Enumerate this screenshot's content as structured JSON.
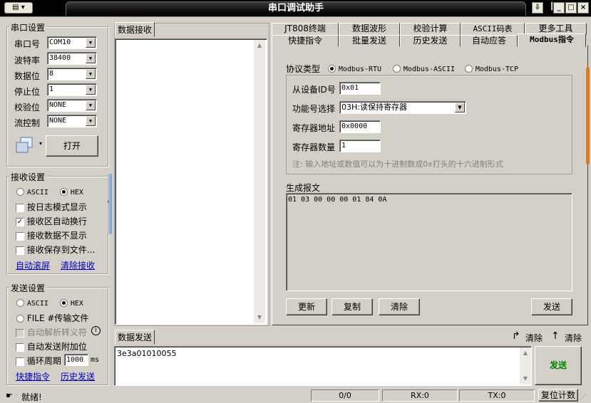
{
  "window": {
    "title": "串口调试助手",
    "sys_menu": "▤ ▾"
  },
  "serial": {
    "title": "串口设置",
    "rows": [
      {
        "label": "串口号",
        "value": "COM10"
      },
      {
        "label": "波特率",
        "value": "38400"
      },
      {
        "label": "数据位",
        "value": "8"
      },
      {
        "label": "停止位",
        "value": "1"
      },
      {
        "label": "校验位",
        "value": "NONE"
      },
      {
        "label": "流控制",
        "value": "NONE"
      }
    ],
    "open_label": "打开"
  },
  "receive": {
    "title": "接收设置",
    "ascii": "ASCII",
    "hex": "HEX",
    "options": [
      {
        "label": "按日志模式显示",
        "checked": false
      },
      {
        "label": "接收区自动换行",
        "checked": true
      },
      {
        "label": "接收数据不显示",
        "checked": false
      },
      {
        "label": "接收保存到文件...",
        "checked": false
      }
    ],
    "auto_scroll": "自动滚屏",
    "clear_recv": "清除接收"
  },
  "send": {
    "title": "发送设置",
    "ascii": "ASCII",
    "hex": "HEX",
    "file": "FILE #传输文件",
    "auto_escape": "自动解析转义符",
    "auto_append": "自动发送附加位",
    "loop_label": "循环周期",
    "loop_value": "1000",
    "loop_unit": "ms",
    "quick_cmd": "快捷指令",
    "history": "历史发送"
  },
  "recv_area": {
    "title": "数据接收"
  },
  "send_area": {
    "title": "数据发送",
    "content": "3e3a01010055",
    "clear1": "清除",
    "clear2": "清除",
    "send_label": "发送"
  },
  "tabs_row1": [
    "JT808终端",
    "数据波形",
    "校验计算",
    "ASCII码表",
    "更多工具"
  ],
  "tabs_row2": [
    "快捷指令",
    "批量发送",
    "历史发送",
    "自动应答",
    "Modbus指令"
  ],
  "modbus": {
    "protocol_label": "协议类型",
    "protocols": [
      "Modbus-RTU",
      "Modbus-ASCII",
      "Modbus-TCP"
    ],
    "slave_label": "从设备ID号",
    "slave_value": "0x01",
    "func_label": "功能号选择",
    "func_value": "03H:读保持寄存器",
    "addr_label": "寄存器地址",
    "addr_value": "0x0000",
    "count_label": "寄存器数量",
    "count_value": "1",
    "note": "注: 输入地址或数值可以为十进制数或0x打头的十六进制形式",
    "gen_label": "生成报文",
    "gen_value": "01 03 00 00 00 01 84 0A",
    "btn_refresh": "更新",
    "btn_copy": "复制",
    "btn_clear": "清除",
    "btn_send": "发送"
  },
  "status": {
    "text": "就绪!",
    "count": "0/0",
    "rx": "RX:0",
    "tx": "TX:0",
    "reset": "复位计数"
  }
}
